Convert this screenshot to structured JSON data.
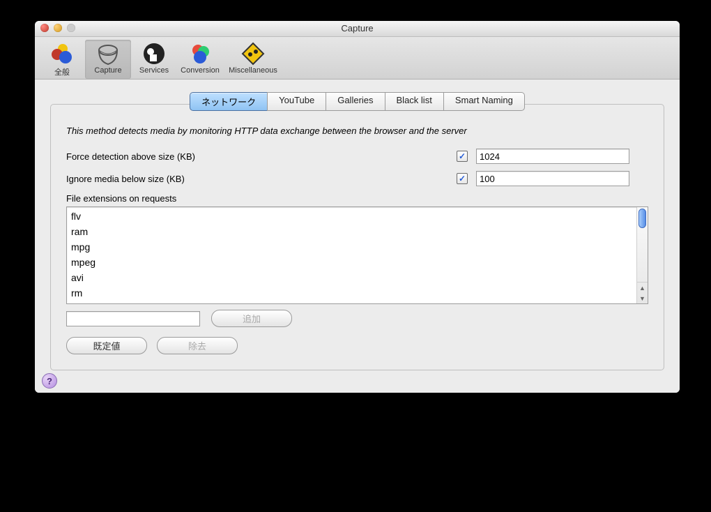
{
  "window": {
    "title": "Capture"
  },
  "toolbar": {
    "items": [
      {
        "label": "全般"
      },
      {
        "label": "Capture"
      },
      {
        "label": "Services"
      },
      {
        "label": "Conversion"
      },
      {
        "label": "Miscellaneous"
      }
    ]
  },
  "tabs": [
    {
      "label": "ネットワーク"
    },
    {
      "label": "YouTube"
    },
    {
      "label": "Galleries"
    },
    {
      "label": "Black list"
    },
    {
      "label": "Smart Naming"
    }
  ],
  "network": {
    "description": "This method detects media by monitoring HTTP data exchange between the browser and the server",
    "forceLabel": "Force detection above size (KB)",
    "forceChecked": "✓",
    "forceValue": "1024",
    "ignoreLabel": "Ignore media below size (KB)",
    "ignoreChecked": "✓",
    "ignoreValue": "100",
    "extLabel": "File extensions on requests",
    "extensions": [
      "flv",
      "ram",
      "mpg",
      "mpeg",
      "avi",
      "rm"
    ],
    "addValue": "",
    "addBtn": "追加",
    "defaultsBtn": "既定値",
    "removeBtn": "除去"
  },
  "help": "?"
}
